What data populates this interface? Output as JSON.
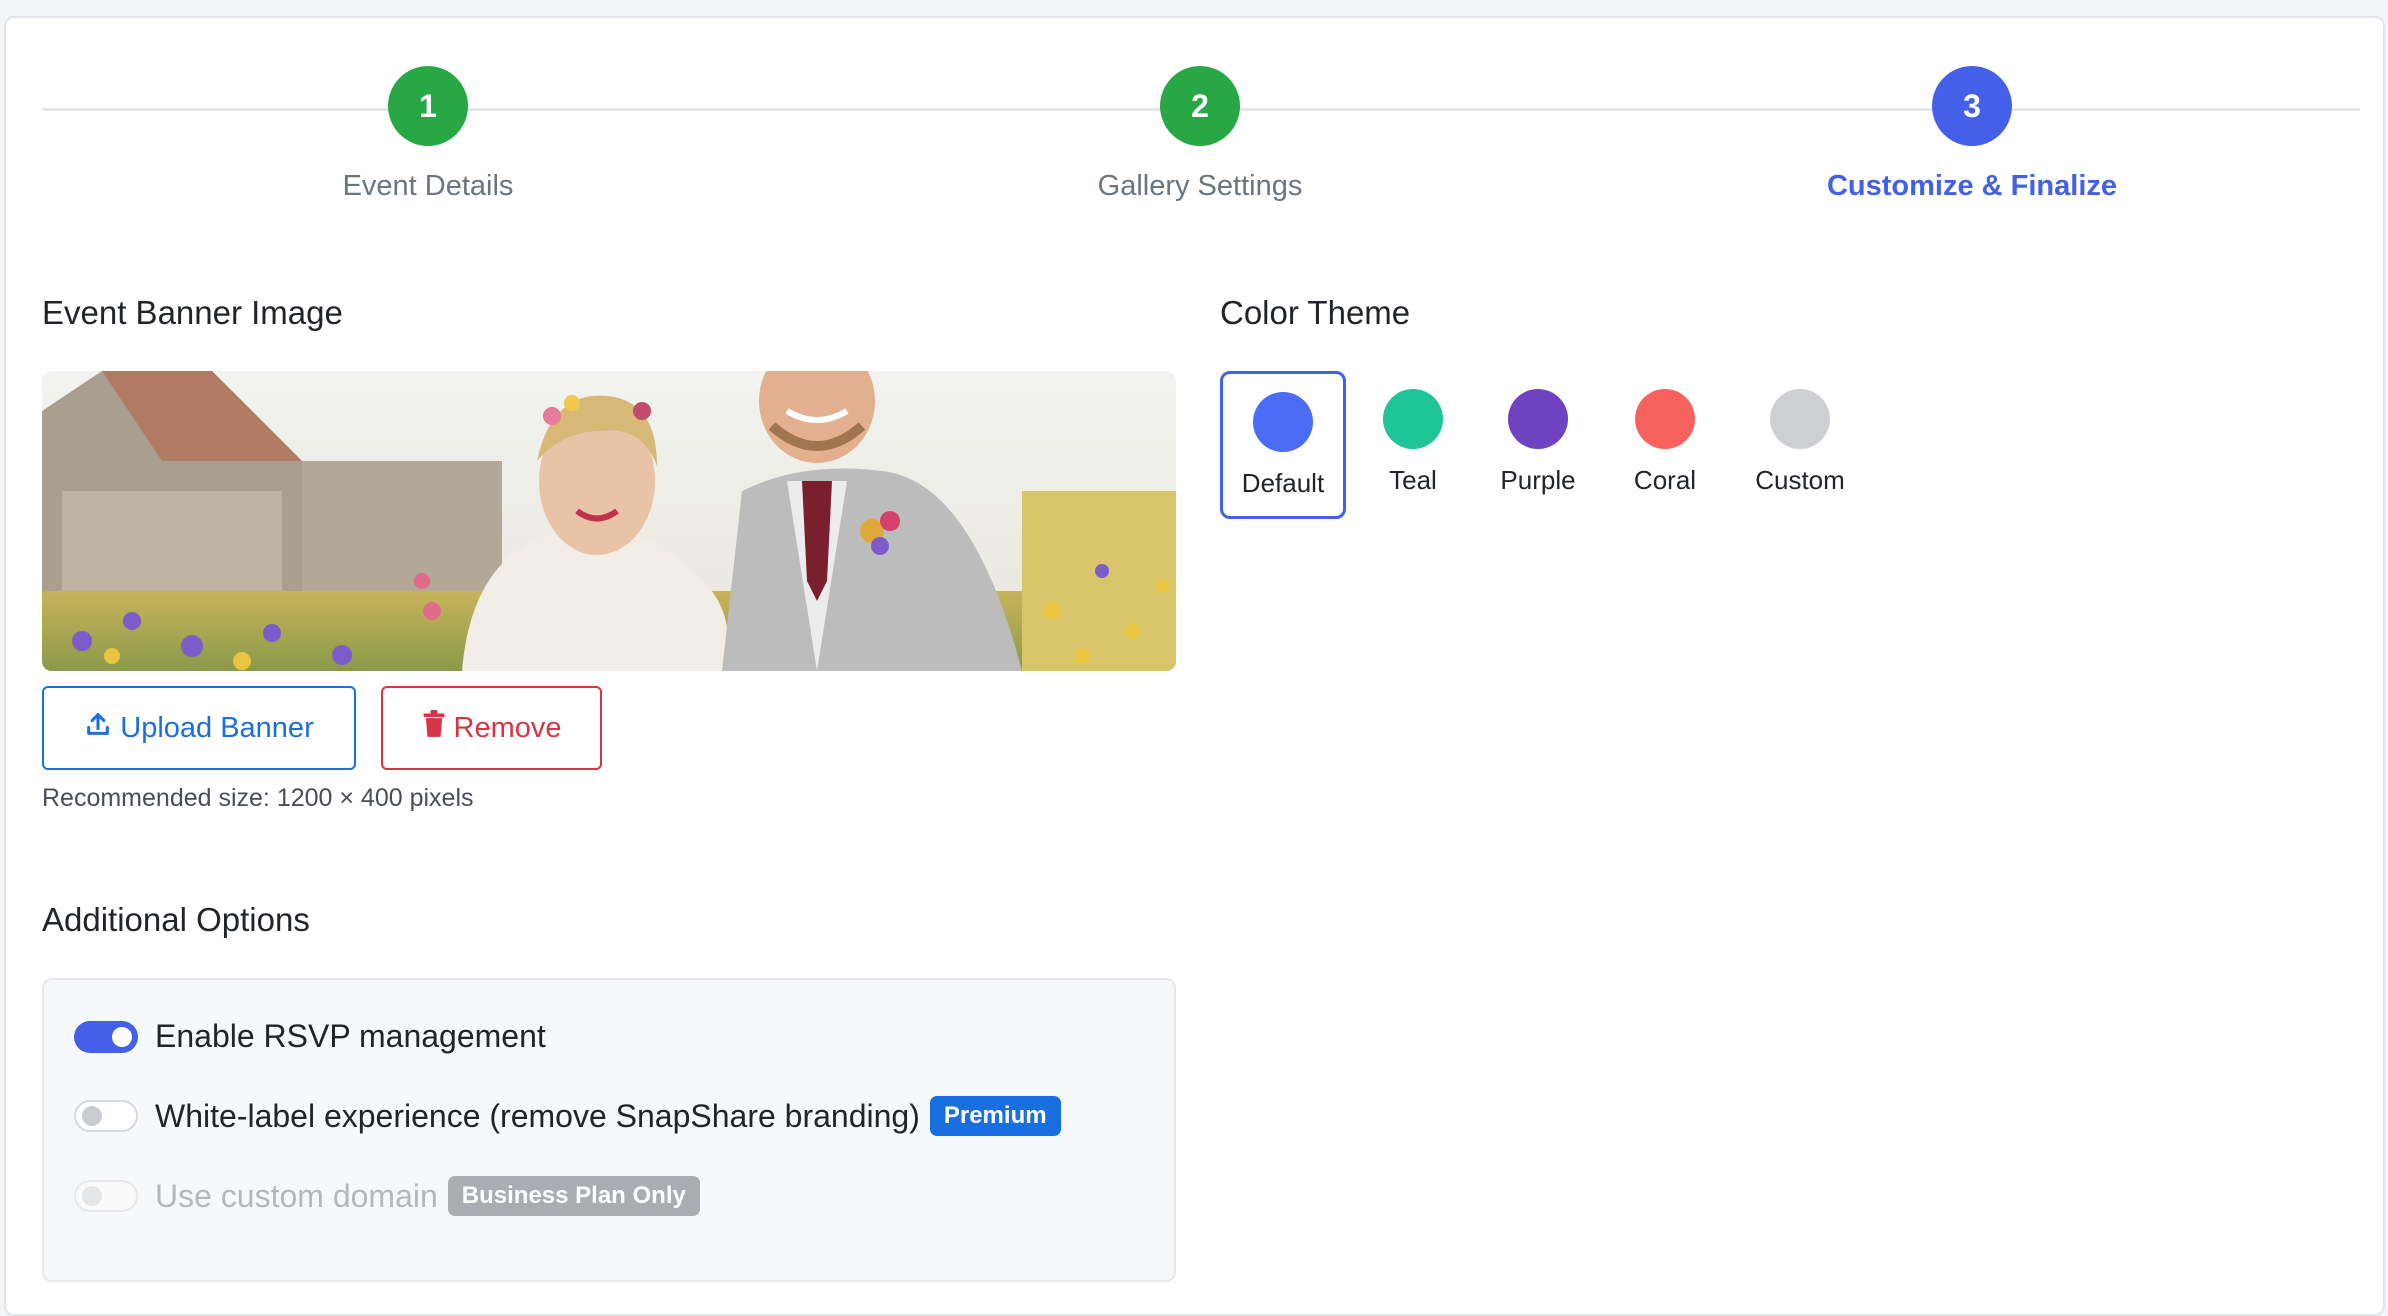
{
  "steps": [
    {
      "number": "1",
      "label": "Event Details",
      "color": "#28a745"
    },
    {
      "number": "2",
      "label": "Gallery Settings",
      "color": "#28a745"
    },
    {
      "number": "3",
      "label": "Customize & Finalize",
      "color": "#4460e8"
    }
  ],
  "banner": {
    "title": "Event Banner Image",
    "upload_label": "Upload Banner",
    "remove_label": "Remove",
    "hint": "Recommended size: 1200 × 400 pixels"
  },
  "theme": {
    "title": "Color Theme",
    "options": [
      {
        "label": "Default",
        "color": "#4a6cf7",
        "selected": true
      },
      {
        "label": "Teal",
        "color": "#1fc497"
      },
      {
        "label": "Purple",
        "color": "#6f42c1"
      },
      {
        "label": "Coral",
        "color": "#f7625e"
      },
      {
        "label": "Custom",
        "color": "#cdcfd2"
      }
    ]
  },
  "options": {
    "title": "Additional Options",
    "items": [
      {
        "label": "Enable RSVP management",
        "state": "on"
      },
      {
        "label": "White-label experience (remove SnapShare branding)",
        "state": "off",
        "badge": "Premium"
      },
      {
        "label": "Use custom domain",
        "state": "disabled",
        "badge": "Business Plan Only"
      }
    ]
  }
}
